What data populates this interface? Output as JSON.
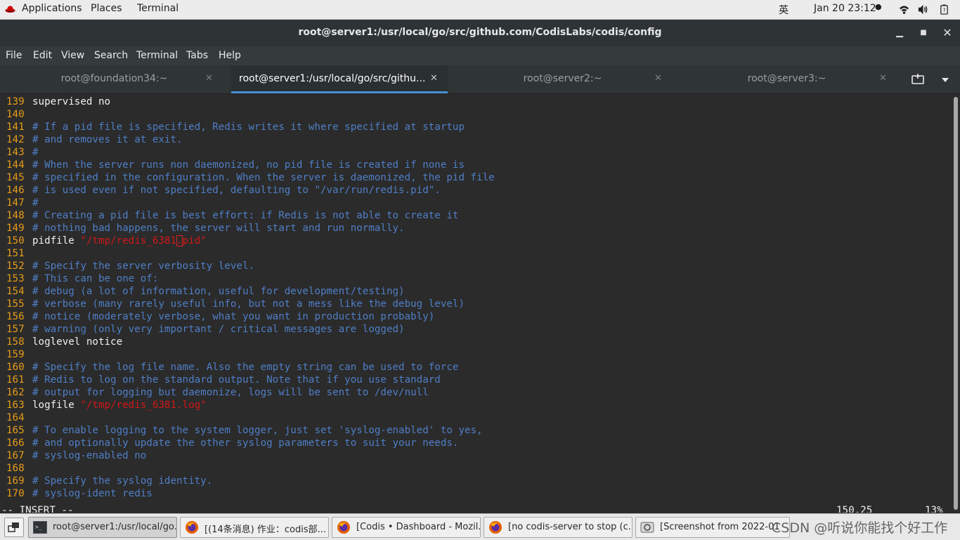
{
  "topbar": {
    "applications": "Applications",
    "places": "Places",
    "terminal": "Terminal",
    "input_method": "英",
    "datetime": "Jan 20  23:12",
    "icons": [
      "redhat-icon",
      "wifi-icon",
      "volume-icon",
      "power-icon"
    ]
  },
  "window": {
    "title": "root@server1:/usr/local/go/src/github.com/CodisLabs/codis/config",
    "controls": [
      "minimize-icon",
      "maximize-icon",
      "close-icon"
    ]
  },
  "menubar": [
    "File",
    "Edit",
    "View",
    "Search",
    "Terminal",
    "Tabs",
    "Help"
  ],
  "tabs": [
    {
      "label": "root@foundation34:~",
      "active": false
    },
    {
      "label": "root@server1:/usr/local/go/src/githu...",
      "active": true
    },
    {
      "label": "root@server2:~",
      "active": false
    },
    {
      "label": "root@server3:~",
      "active": false
    }
  ],
  "editor": {
    "lines": [
      {
        "n": "139",
        "kind": "text",
        "text": "supervised no"
      },
      {
        "n": "140",
        "kind": "blank",
        "text": ""
      },
      {
        "n": "141",
        "kind": "comment",
        "text": "# If a pid file is specified, Redis writes it where specified at startup"
      },
      {
        "n": "142",
        "kind": "comment",
        "text": "# and removes it at exit."
      },
      {
        "n": "143",
        "kind": "comment",
        "text": "#"
      },
      {
        "n": "144",
        "kind": "comment",
        "text": "# When the server runs non daemonized, no pid file is created if none is"
      },
      {
        "n": "145",
        "kind": "comment",
        "text": "# specified in the configuration. When the server is daemonized, the pid file"
      },
      {
        "n": "146",
        "kind": "comment",
        "text": "# is used even if not specified, defaulting to \"/var/run/redis.pid\"."
      },
      {
        "n": "147",
        "kind": "comment",
        "text": "#"
      },
      {
        "n": "148",
        "kind": "comment",
        "text": "# Creating a pid file is best effort: if Redis is not able to create it"
      },
      {
        "n": "149",
        "kind": "comment",
        "text": "# nothing bad happens, the server will start and run normally."
      },
      {
        "n": "150",
        "kind": "pidfile",
        "key": "pidfile ",
        "pre": "\"/tmp/redis_6381",
        "cur": ".",
        "post": "pid\""
      },
      {
        "n": "151",
        "kind": "blank",
        "text": ""
      },
      {
        "n": "152",
        "kind": "comment",
        "text": "# Specify the server verbosity level."
      },
      {
        "n": "153",
        "kind": "comment",
        "text": "# This can be one of:"
      },
      {
        "n": "154",
        "kind": "comment",
        "text": "# debug (a lot of information, useful for development/testing)"
      },
      {
        "n": "155",
        "kind": "comment",
        "text": "# verbose (many rarely useful info, but not a mess like the debug level)"
      },
      {
        "n": "156",
        "kind": "comment",
        "text": "# notice (moderately verbose, what you want in production probably)"
      },
      {
        "n": "157",
        "kind": "comment",
        "text": "# warning (only very important / critical messages are logged)"
      },
      {
        "n": "158",
        "kind": "text",
        "text": "loglevel notice"
      },
      {
        "n": "159",
        "kind": "blank",
        "text": ""
      },
      {
        "n": "160",
        "kind": "comment",
        "text": "# Specify the log file name. Also the empty string can be used to force"
      },
      {
        "n": "161",
        "kind": "comment",
        "text": "# Redis to log on the standard output. Note that if you use standard"
      },
      {
        "n": "162",
        "kind": "comment",
        "text": "# output for logging but daemonize, logs will be sent to /dev/null"
      },
      {
        "n": "163",
        "kind": "keyval",
        "key": "logfile ",
        "val": "\"/tmp/redis_6381.log\""
      },
      {
        "n": "164",
        "kind": "blank",
        "text": ""
      },
      {
        "n": "165",
        "kind": "comment",
        "text": "# To enable logging to the system logger, just set 'syslog-enabled' to yes,"
      },
      {
        "n": "166",
        "kind": "comment",
        "text": "# and optionally update the other syslog parameters to suit your needs."
      },
      {
        "n": "167",
        "kind": "comment",
        "text": "# syslog-enabled no"
      },
      {
        "n": "168",
        "kind": "blank",
        "text": ""
      },
      {
        "n": "169",
        "kind": "comment",
        "text": "# Specify the syslog identity."
      },
      {
        "n": "170",
        "kind": "comment",
        "text": "# syslog-ident redis"
      }
    ],
    "status_mode": "-- INSERT --",
    "status_position": "150,25",
    "status_percent": "13%"
  },
  "taskbar": {
    "items": [
      {
        "label": "root@server1:/usr/local/go...",
        "icon": "terminal-icon",
        "active": true
      },
      {
        "label": "[(14条消息) 作业：codis部...",
        "icon": "firefox-icon",
        "active": false
      },
      {
        "label": "[Codis • Dashboard - Mozil...",
        "icon": "firefox-icon",
        "active": false
      },
      {
        "label": "[no codis-server to stop (c...",
        "icon": "firefox-icon",
        "active": false
      },
      {
        "label": "[Screenshot from 2022-01",
        "icon": "screenshot-icon",
        "active": false
      }
    ],
    "watermark": "CSDN @听说你能找个好工作"
  },
  "colors": {
    "terminal_bg": "#2b2b2b",
    "line_number": "#e69c19",
    "comment": "#4f7ec6",
    "string": "#d01818",
    "text": "#f0f0f0",
    "tab_accent": "#4a90d9"
  }
}
